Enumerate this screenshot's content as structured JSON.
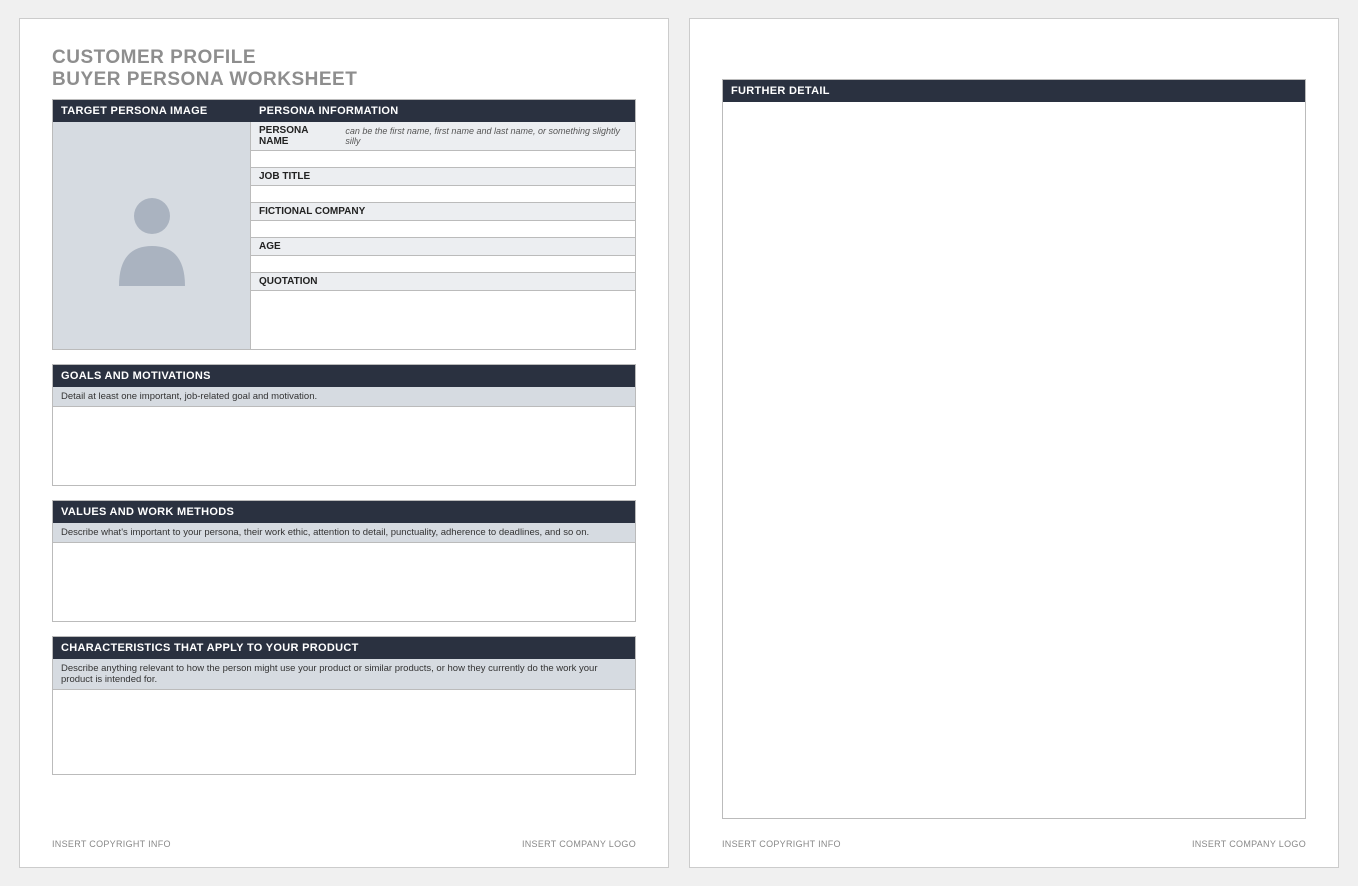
{
  "title": {
    "line1": "CUSTOMER PROFILE",
    "line2": "BUYER PERSONA WORKSHEET"
  },
  "headers": {
    "target_image": "TARGET PERSONA IMAGE",
    "persona_info": "PERSONA INFORMATION",
    "goals": "GOALS AND MOTIVATIONS",
    "values": "VALUES AND WORK METHODS",
    "characteristics": "CHARACTERISTICS THAT APPLY TO YOUR PRODUCT",
    "further": "FURTHER DETAIL"
  },
  "fields": {
    "persona_name": {
      "label": "PERSONA NAME",
      "hint": "can be the first name, first name and last name, or something slightly silly",
      "value": ""
    },
    "job_title": {
      "label": "JOB TITLE",
      "value": ""
    },
    "fictional_company": {
      "label": "FICTIONAL COMPANY",
      "value": ""
    },
    "age": {
      "label": "AGE",
      "value": ""
    },
    "quotation": {
      "label": "QUOTATION",
      "value": ""
    }
  },
  "hints": {
    "goals": "Detail at least one important, job-related goal and motivation.",
    "values": "Describe what's important to your persona, their work ethic, attention to detail, punctuality, adherence to deadlines, and so on.",
    "characteristics": "Describe anything relevant to how the person might use your product or similar products, or how they currently do the work your product is intended for."
  },
  "footer": {
    "left": "INSERT COPYRIGHT INFO",
    "right": "INSERT COMPANY LOGO"
  }
}
